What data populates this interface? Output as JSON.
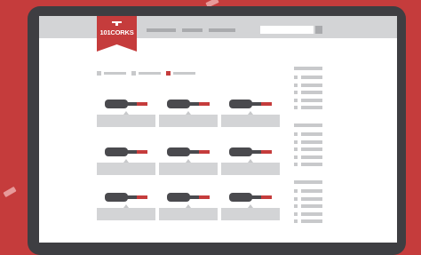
{
  "app": {
    "logo_text": "101CORKS",
    "brand_color": "#c53c3c",
    "accent_color": "#c53c3c"
  },
  "header": {
    "nav_items": [
      "nav-item-1",
      "nav-item-2",
      "nav-item-3"
    ],
    "search": {
      "icon": "search-icon"
    }
  },
  "filters": {
    "items": [
      {
        "name": "filter-1",
        "selected": false
      },
      {
        "name": "filter-2",
        "selected": false
      },
      {
        "name": "filter-3",
        "selected": true
      }
    ]
  },
  "products": {
    "count": 9,
    "columns": 3,
    "icon": "wine-bottle-icon"
  },
  "sidebar": {
    "groups": [
      {
        "name": "sidebar-group-1",
        "rows": 5
      },
      {
        "name": "sidebar-group-2",
        "rows": 5
      },
      {
        "name": "sidebar-group-3",
        "rows": 5
      }
    ]
  }
}
